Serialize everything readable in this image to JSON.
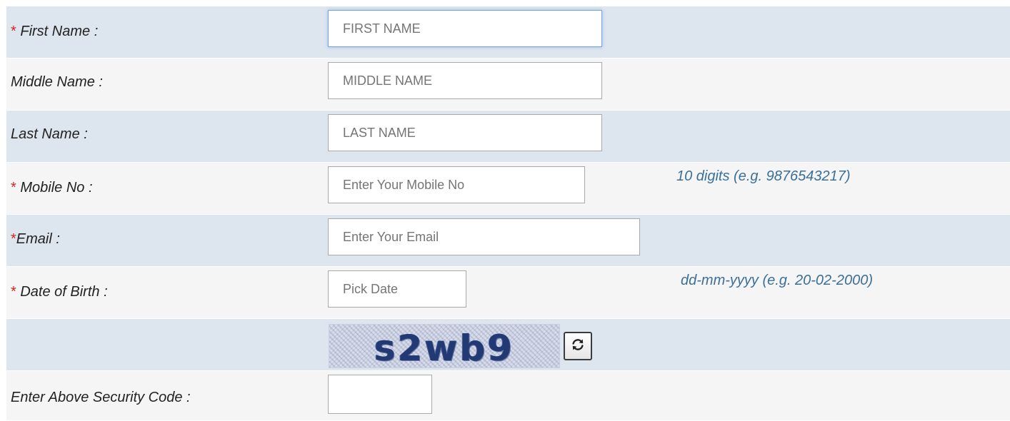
{
  "form": {
    "required_mark": "*",
    "first_name": {
      "label": "First Name :",
      "placeholder": "FIRST NAME",
      "value": ""
    },
    "middle_name": {
      "label": "Middle Name :",
      "placeholder": "MIDDLE NAME",
      "value": ""
    },
    "last_name": {
      "label": "Last Name :",
      "placeholder": "LAST NAME",
      "value": ""
    },
    "mobile": {
      "label": "Mobile No :",
      "placeholder": "Enter Your Mobile No",
      "value": "",
      "hint": "10 digits (e.g. 9876543217)"
    },
    "email": {
      "label": "Email :",
      "placeholder": "Enter Your Email",
      "value": ""
    },
    "dob": {
      "label": "Date of Birth :",
      "placeholder": "Pick Date",
      "value": "",
      "hint": "dd-mm-yyyy (e.g. 20-02-2000)"
    },
    "captcha": {
      "code": "s2wb9",
      "refresh_icon": "refresh-icon"
    },
    "security_code": {
      "label": "Enter Above Security Code :",
      "value": ""
    }
  },
  "colors": {
    "row_odd": "#dde5ee",
    "row_even": "#f5f5f5",
    "required": "#d9231d",
    "hint": "#3a6f9a"
  }
}
